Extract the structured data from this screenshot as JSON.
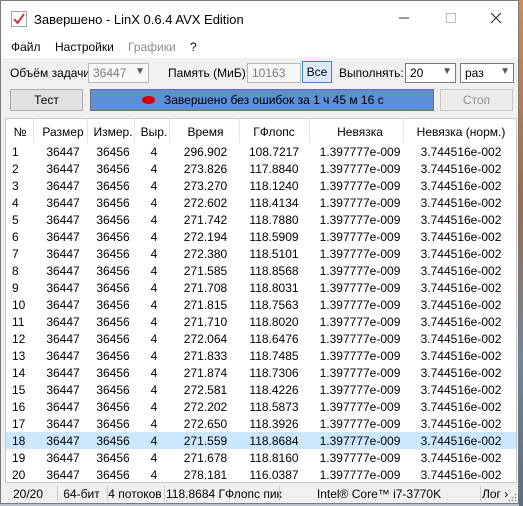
{
  "window": {
    "title": "Завершено - LinX 0.6.4 AVX Edition"
  },
  "menu": [
    {
      "label": "Файл",
      "disabled": false
    },
    {
      "label": "Настройки",
      "disabled": false
    },
    {
      "label": "Графики",
      "disabled": true
    },
    {
      "label": "?",
      "disabled": false
    }
  ],
  "controls": {
    "task_size_label": "Объём задачи:",
    "task_size_value": "36447",
    "memory_label": "Память (МиБ):",
    "memory_value": "10163",
    "all_button": "Все",
    "run_label": "Выполнять:",
    "run_count": "20",
    "run_unit": "раз"
  },
  "actions": {
    "test_button": "Тест",
    "stop_button": "Стоп",
    "progress_text": "Завершено без ошибок за 1 ч 45 м 16 с",
    "progress_fraction": 1.0,
    "status_dot_color": "#d40000"
  },
  "table": {
    "columns": [
      "№",
      "Размер",
      "Измер.",
      "Выр.",
      "Время",
      "ГФлопс",
      "Невязка",
      "Невязка (норм.)"
    ],
    "rows": [
      [
        "1",
        "36447",
        "36456",
        "4",
        "296.902",
        "108.7217",
        "1.397777e-009",
        "3.744516e-002"
      ],
      [
        "2",
        "36447",
        "36456",
        "4",
        "273.826",
        "117.8840",
        "1.397777e-009",
        "3.744516e-002"
      ],
      [
        "3",
        "36447",
        "36456",
        "4",
        "273.270",
        "118.1240",
        "1.397777e-009",
        "3.744516e-002"
      ],
      [
        "4",
        "36447",
        "36456",
        "4",
        "272.602",
        "118.4134",
        "1.397777e-009",
        "3.744516e-002"
      ],
      [
        "5",
        "36447",
        "36456",
        "4",
        "271.742",
        "118.7880",
        "1.397777e-009",
        "3.744516e-002"
      ],
      [
        "6",
        "36447",
        "36456",
        "4",
        "272.194",
        "118.5909",
        "1.397777e-009",
        "3.744516e-002"
      ],
      [
        "7",
        "36447",
        "36456",
        "4",
        "272.380",
        "118.5101",
        "1.397777e-009",
        "3.744516e-002"
      ],
      [
        "8",
        "36447",
        "36456",
        "4",
        "271.585",
        "118.8568",
        "1.397777e-009",
        "3.744516e-002"
      ],
      [
        "9",
        "36447",
        "36456",
        "4",
        "271.708",
        "118.8031",
        "1.397777e-009",
        "3.744516e-002"
      ],
      [
        "10",
        "36447",
        "36456",
        "4",
        "271.815",
        "118.7563",
        "1.397777e-009",
        "3.744516e-002"
      ],
      [
        "11",
        "36447",
        "36456",
        "4",
        "271.710",
        "118.8020",
        "1.397777e-009",
        "3.744516e-002"
      ],
      [
        "12",
        "36447",
        "36456",
        "4",
        "272.064",
        "118.6476",
        "1.397777e-009",
        "3.744516e-002"
      ],
      [
        "13",
        "36447",
        "36456",
        "4",
        "271.833",
        "118.7485",
        "1.397777e-009",
        "3.744516e-002"
      ],
      [
        "14",
        "36447",
        "36456",
        "4",
        "271.874",
        "118.7306",
        "1.397777e-009",
        "3.744516e-002"
      ],
      [
        "15",
        "36447",
        "36456",
        "4",
        "272.581",
        "118.4226",
        "1.397777e-009",
        "3.744516e-002"
      ],
      [
        "16",
        "36447",
        "36456",
        "4",
        "272.202",
        "118.5873",
        "1.397777e-009",
        "3.744516e-002"
      ],
      [
        "17",
        "36447",
        "36456",
        "4",
        "272.650",
        "118.3926",
        "1.397777e-009",
        "3.744516e-002"
      ],
      [
        "18",
        "36447",
        "36456",
        "4",
        "271.559",
        "118.8684",
        "1.397777e-009",
        "3.744516e-002"
      ],
      [
        "19",
        "36447",
        "36456",
        "4",
        "271.678",
        "118.8160",
        "1.397777e-009",
        "3.744516e-002"
      ],
      [
        "20",
        "36447",
        "36456",
        "4",
        "278.181",
        "116.0387",
        "1.397777e-009",
        "3.744516e-002"
      ]
    ],
    "selected_row": 18
  },
  "status": {
    "progress": "20/20",
    "bits": "64-бит",
    "threads": "4 потоков",
    "peak": "118.8684 ГФлопс пик",
    "cpu": "Intel® Core™ i7-3770K",
    "log": "Лог ›"
  },
  "colors": {
    "progress_bar": "#5b8fd6",
    "selected_row": "#cce8ff",
    "all_button_border": "#3c7fb1"
  }
}
